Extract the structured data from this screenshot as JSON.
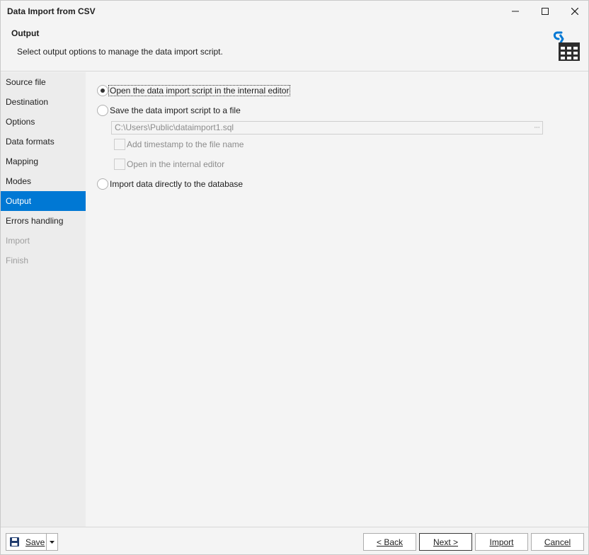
{
  "window": {
    "title": "Data Import from CSV",
    "icons": [
      "minimize-icon",
      "maximize-icon",
      "close-icon"
    ]
  },
  "header": {
    "title": "Output",
    "subtitle": "Select output options to manage the data import script."
  },
  "nav": {
    "items": [
      {
        "label": "Source file",
        "state": "normal"
      },
      {
        "label": "Destination",
        "state": "normal"
      },
      {
        "label": "Options",
        "state": "normal"
      },
      {
        "label": "Data formats",
        "state": "normal"
      },
      {
        "label": "Mapping",
        "state": "normal"
      },
      {
        "label": "Modes",
        "state": "normal"
      },
      {
        "label": "Output",
        "state": "active"
      },
      {
        "label": "Errors handling",
        "state": "normal"
      },
      {
        "label": "Import",
        "state": "disabled"
      },
      {
        "label": "Finish",
        "state": "disabled"
      }
    ]
  },
  "output": {
    "option_open_editor": "Open the data import script in the internal editor",
    "option_save_file": "Save the data import script to a file",
    "file_path": "C:\\Users\\Public\\dataimport1.sql",
    "browse": "···",
    "cb_timestamp": "Add timestamp to the file name",
    "cb_open_editor": "Open in the internal editor",
    "option_import_direct": "Import data directly to the database",
    "selected": "open_editor"
  },
  "footer": {
    "save": "Save",
    "back": "< Back",
    "next": "Next >",
    "import": "Import",
    "cancel": "Cancel"
  },
  "colors": {
    "accent": "#0078d4",
    "icon_dark": "#2d2d2d"
  }
}
